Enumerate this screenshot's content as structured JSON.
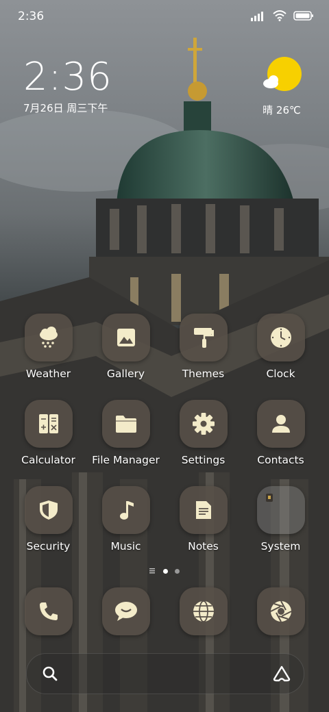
{
  "status_bar": {
    "time": "2:36"
  },
  "clock_widget": {
    "time": "2:36",
    "date": "7月26日 周三下午"
  },
  "weather_widget": {
    "text": "晴 26℃",
    "icon": "sunny-cloud-icon",
    "sun_color": "#F7D000"
  },
  "apps": [
    {
      "label": "Weather",
      "icon": "weather-icon"
    },
    {
      "label": "Gallery",
      "icon": "gallery-icon"
    },
    {
      "label": "Themes",
      "icon": "themes-icon"
    },
    {
      "label": "Clock",
      "icon": "clock-icon"
    },
    {
      "label": "Calculator",
      "icon": "calculator-icon"
    },
    {
      "label": "File Manager",
      "icon": "folder-icon"
    },
    {
      "label": "Settings",
      "icon": "gear-icon"
    },
    {
      "label": "Contacts",
      "icon": "person-icon"
    },
    {
      "label": "Security",
      "icon": "shield-icon"
    },
    {
      "label": "Music",
      "icon": "music-note-icon"
    },
    {
      "label": "Notes",
      "icon": "note-icon"
    },
    {
      "label": "System",
      "icon": "folder-glass-icon"
    }
  ],
  "dock": [
    {
      "icon": "phone-icon"
    },
    {
      "icon": "message-icon"
    },
    {
      "icon": "browser-icon"
    },
    {
      "icon": "camera-icon"
    }
  ],
  "search_bar": {
    "left_icon": "search-icon",
    "right_icon": "assistant-icon"
  },
  "colors": {
    "icon_bg": "#585048",
    "icon_fg": "#F3EBC9",
    "accent_sun": "#F7D000"
  }
}
